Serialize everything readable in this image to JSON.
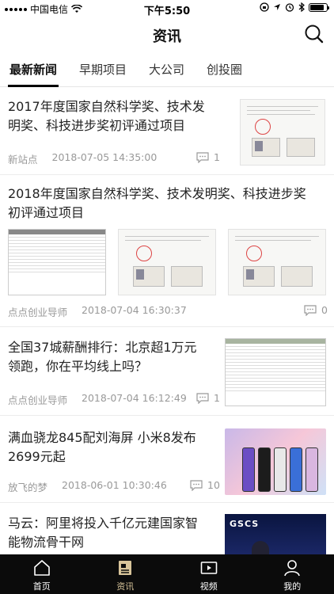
{
  "status_bar": {
    "carrier": "中国电信",
    "time": "下午5:50",
    "battery_level": 0.85
  },
  "nav": {
    "title": "资讯",
    "search_icon": "search-icon"
  },
  "tabs": [
    {
      "label": "最新新闻",
      "active": true
    },
    {
      "label": "早期项目",
      "active": false
    },
    {
      "label": "大公司",
      "active": false
    },
    {
      "label": "创投圈",
      "active": false
    }
  ],
  "feed": [
    {
      "title_line1": "2017年度国家自然科学奖、技术发",
      "title_line2": "明奖、科技进步奖初评通过项目",
      "source": "新站点",
      "time": "2018-07-05 14:35:00",
      "comments": "1",
      "thumb": "document-with-seal"
    },
    {
      "title_line1": "2018年度国家自然科学奖、技术发明奖、科技进步奖",
      "title_line2": "初评通过项目",
      "source": "点点创业导师",
      "time": "2018-07-04 16:30:37",
      "comments": "0",
      "thumbs": [
        "table-document",
        "document-with-seal",
        "document-with-seal"
      ]
    },
    {
      "title_line1": "全国37城薪酬排行：北京超1万元",
      "title_line2": "领跑，你在平均线上吗？",
      "source": "点点创业导师",
      "time": "2018-07-04 16:12:49",
      "comments": "1",
      "thumb": "salary-table"
    },
    {
      "title_line1": "满血骁龙845配刘海屏 小米8发布",
      "title_line2": "2699元起",
      "source": "放飞的梦",
      "time": "2018-06-01 10:30:46",
      "comments": "10",
      "thumb": "phones-ad"
    },
    {
      "title_line1": " 马云：阿里将投入千亿元建国家智",
      "title_line2": "能物流骨干网",
      "thumb": "conference-stage",
      "thumb_text": "GSCS"
    }
  ],
  "tabbar": [
    {
      "label": "首页",
      "icon": "home-icon",
      "active": false
    },
    {
      "label": "资讯",
      "icon": "news-icon",
      "active": true
    },
    {
      "label": "视频",
      "icon": "video-icon",
      "active": false
    },
    {
      "label": "我的",
      "icon": "profile-icon",
      "active": false
    }
  ]
}
